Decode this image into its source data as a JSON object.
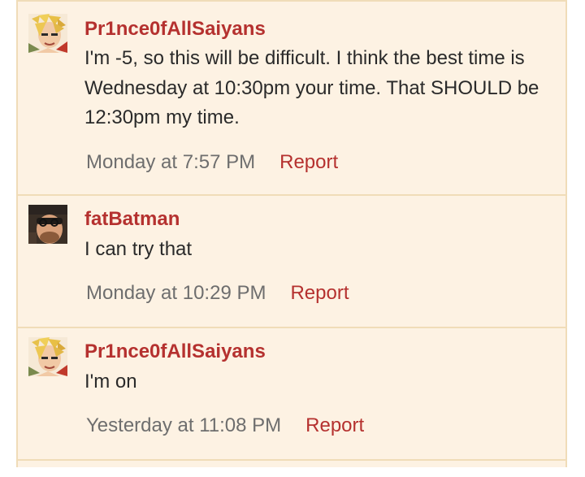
{
  "comments": [
    {
      "author": "Pr1nce0fAllSaiyans",
      "avatar_icon": "anime-avatar-icon",
      "text": "I'm -5, so this will be difficult. I think the best time is Wednesday at 10:30pm your time. That SHOULD be 12:30pm my time.",
      "timestamp": "Monday at 7:57 PM",
      "report_label": "Report"
    },
    {
      "author": "fatBatman",
      "avatar_icon": "photo-avatar-icon",
      "text": "I can try that",
      "timestamp": "Monday at 10:29 PM",
      "report_label": "Report"
    },
    {
      "author": "Pr1nce0fAllSaiyans",
      "avatar_icon": "anime-avatar-icon",
      "text": "I'm on",
      "timestamp": "Yesterday at 11:08 PM",
      "report_label": "Report"
    }
  ],
  "colors": {
    "background": "#fdf2e3",
    "border": "#f0dcb8",
    "author": "#b5312f",
    "link": "#b5312f",
    "timestamp": "#6e6e6e",
    "text": "#2a2a2a"
  }
}
